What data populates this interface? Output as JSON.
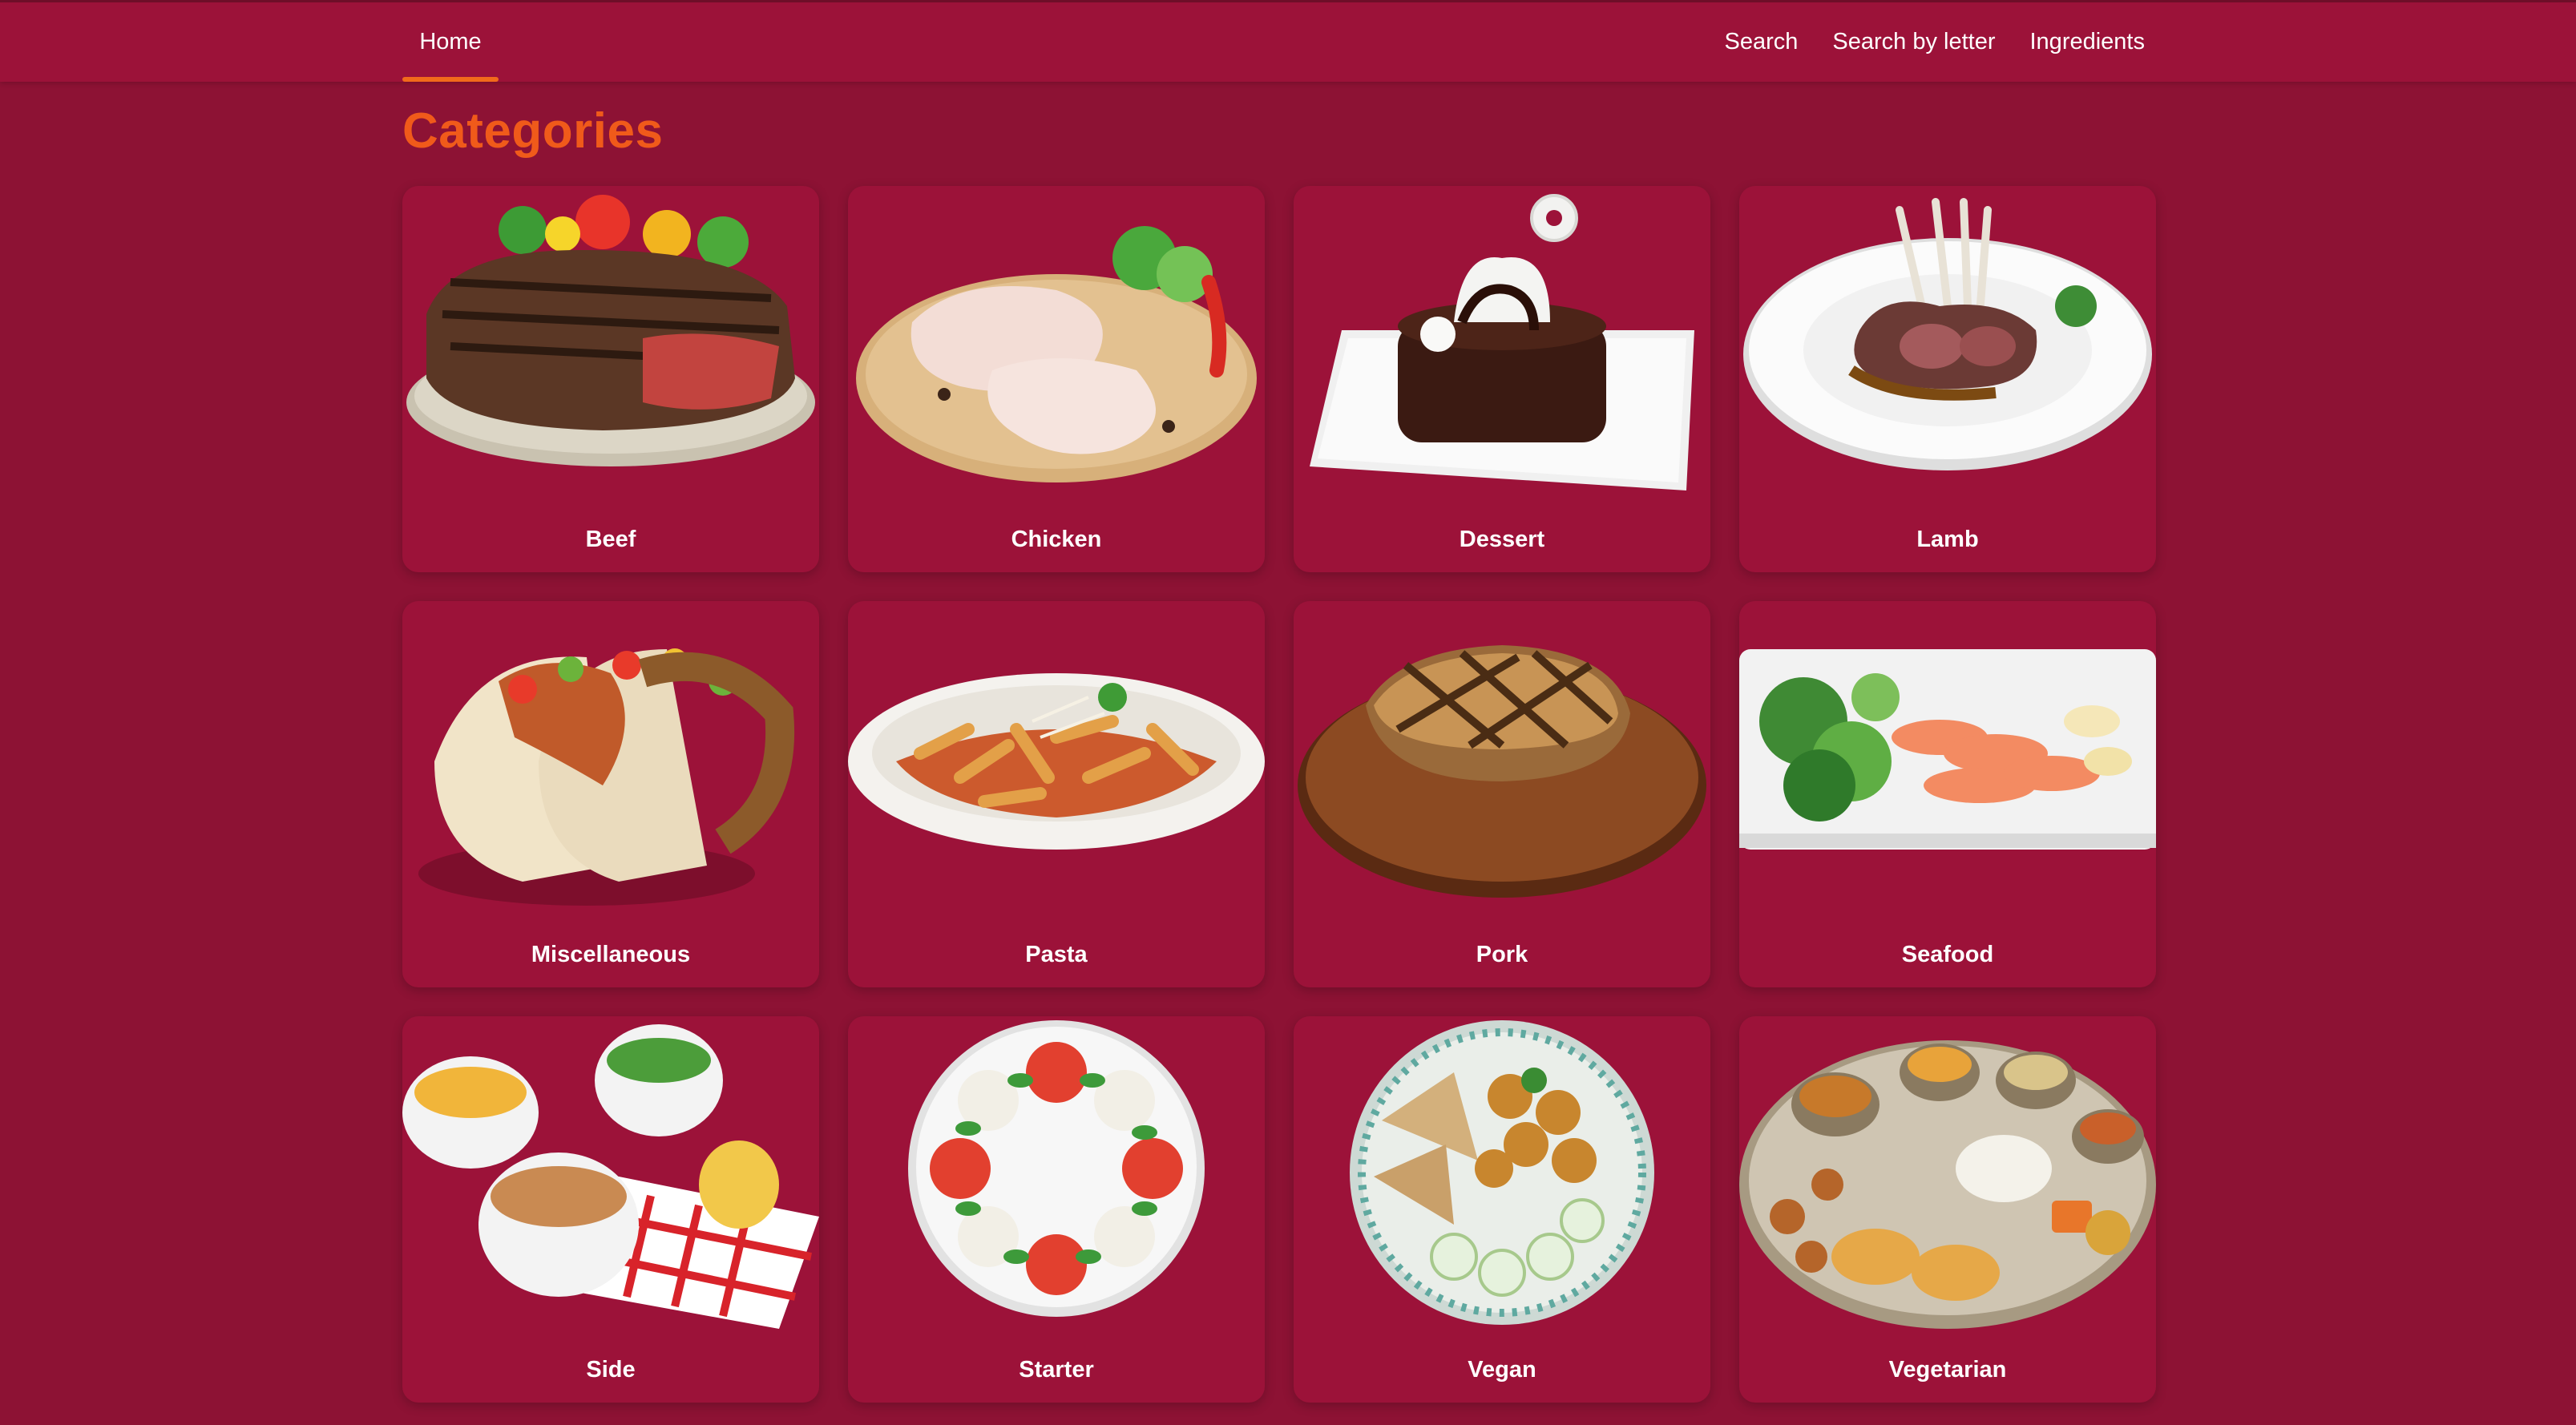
{
  "nav": {
    "home": "Home",
    "links": [
      "Search",
      "Search by letter",
      "Ingredients"
    ]
  },
  "page": {
    "title": "Categories"
  },
  "colors": {
    "background": "#8d1234",
    "card": "#9c1239",
    "accent": "#f05a1a",
    "active_underline": "#f26a1b"
  },
  "categories": [
    {
      "name": "Beef",
      "image": "beef-steak-image"
    },
    {
      "name": "Chicken",
      "image": "chicken-legs-image"
    },
    {
      "name": "Dessert",
      "image": "chocolate-cake-image"
    },
    {
      "name": "Lamb",
      "image": "lamb-chops-image"
    },
    {
      "name": "Miscellaneous",
      "image": "tacos-image"
    },
    {
      "name": "Pasta",
      "image": "penne-pasta-image"
    },
    {
      "name": "Pork",
      "image": "pork-chop-image"
    },
    {
      "name": "Seafood",
      "image": "salmon-plate-image"
    },
    {
      "name": "Side",
      "image": "side-dishes-image"
    },
    {
      "name": "Starter",
      "image": "caprese-salad-image"
    },
    {
      "name": "Vegan",
      "image": "vegan-bowl-image"
    },
    {
      "name": "Vegetarian",
      "image": "thali-platter-image"
    }
  ]
}
